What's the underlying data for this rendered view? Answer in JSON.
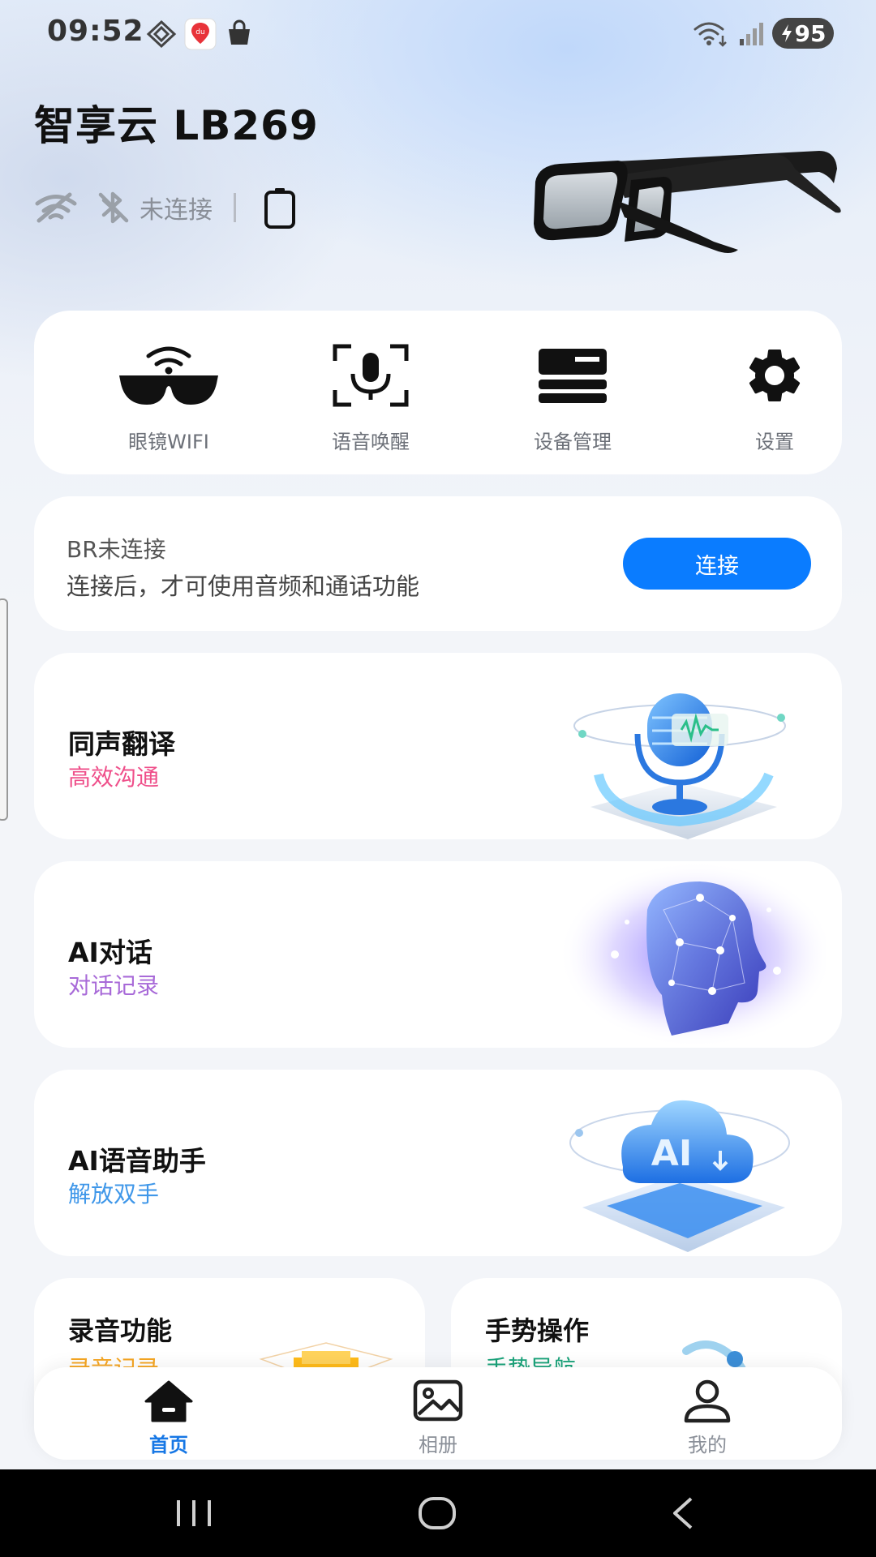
{
  "status_bar": {
    "time": "09:52",
    "battery": "95",
    "icons": [
      "grid-icon",
      "du-app-icon",
      "shopping-bag-icon",
      "wifi-icon",
      "signal-icon",
      "battery-charging-icon"
    ]
  },
  "header": {
    "device_name": "智享云 LB269",
    "connection_status": "未连接"
  },
  "quick_actions": [
    {
      "label": "眼镜WIFI",
      "icon": "glasses-wifi-icon"
    },
    {
      "label": "语音唤醒",
      "icon": "voice-wake-icon"
    },
    {
      "label": "设备管理",
      "icon": "device-manage-icon"
    },
    {
      "label": "设置",
      "icon": "gear-icon"
    }
  ],
  "br_card": {
    "title": "BR未连接",
    "subtitle": "连接后，才可使用音频和通话功能",
    "button_label": "连接"
  },
  "features": [
    {
      "title": "同声翻译",
      "subtitle": "高效沟通",
      "subtitle_color": "#ef4f8a",
      "icon": "microphone-art-icon"
    },
    {
      "title": "AI对话",
      "subtitle": "对话记录",
      "subtitle_color": "#a86ad8",
      "icon": "ai-head-art-icon"
    },
    {
      "title": "AI语音助手",
      "subtitle": "解放双手",
      "subtitle_color": "#3f97e9",
      "icon": "ai-cloud-art-icon"
    }
  ],
  "half_features": [
    {
      "title": "录音功能",
      "subtitle": "录音记录",
      "subtitle_color": "#f5a623"
    },
    {
      "title": "手势操作",
      "subtitle": "手势导航",
      "subtitle_color": "#1aa37a"
    }
  ],
  "bottom_nav": [
    {
      "label": "首页",
      "icon": "home-icon",
      "active": true
    },
    {
      "label": "相册",
      "icon": "gallery-icon",
      "active": false
    },
    {
      "label": "我的",
      "icon": "profile-icon",
      "active": false
    }
  ],
  "colors": {
    "accent": "#0a7cff",
    "nav_active": "#1677e5",
    "nav_inactive": "#8a8f98"
  }
}
